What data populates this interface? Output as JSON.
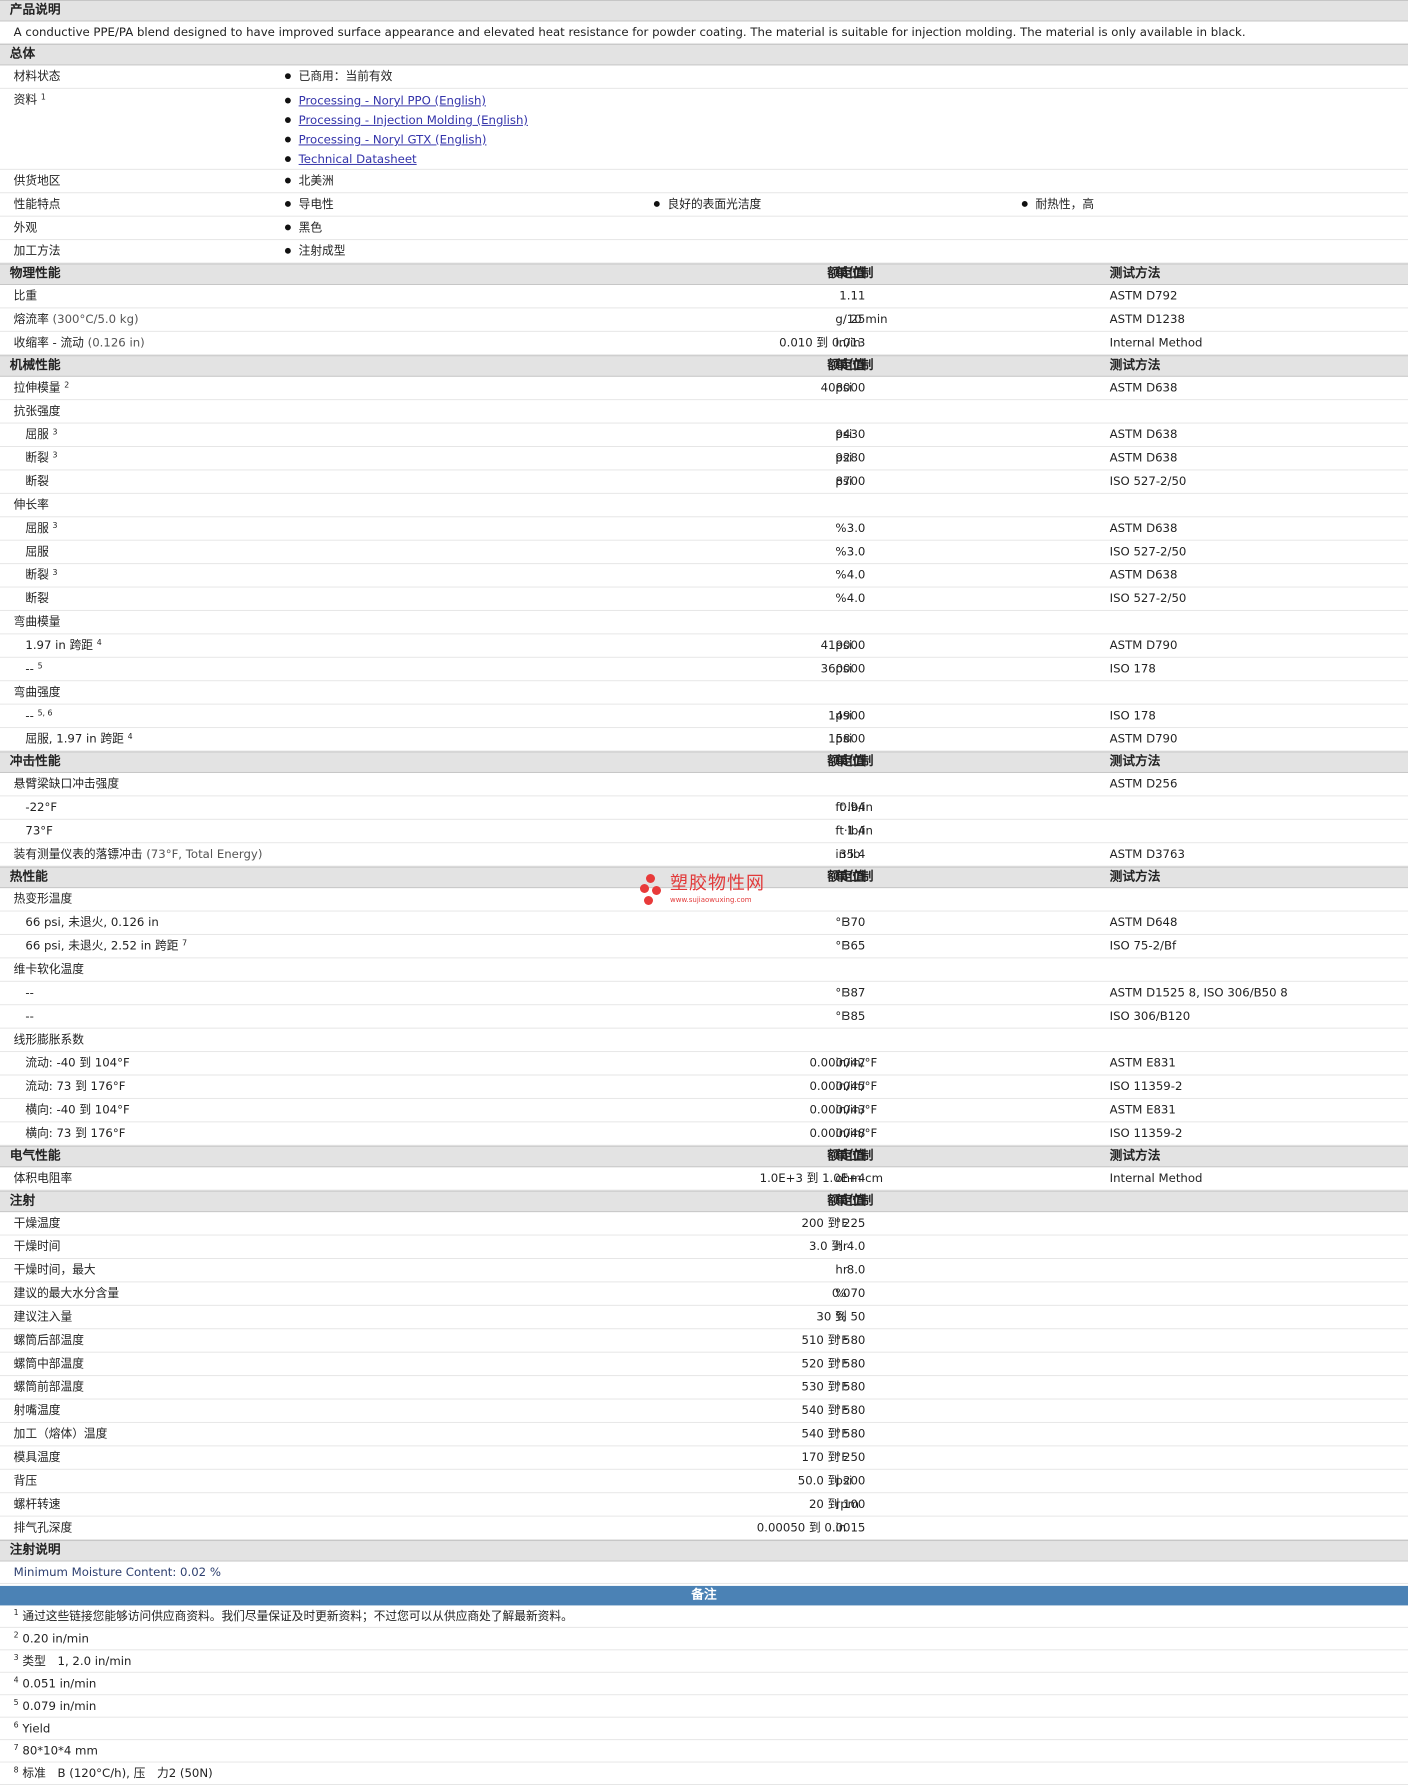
{
  "description": {
    "header": "产品说明",
    "text": "A conductive PPE/PA blend designed to have improved surface appearance and elevated heat resistance for powder coating. The material is suitable for injection molding. The material is only available in black."
  },
  "general": {
    "header": "总体",
    "material_status": {
      "label": "材料状态",
      "value": "已商用：当前有效"
    },
    "documents": {
      "label": "资料",
      "sup": "1",
      "links": [
        "Processing - Noryl PPO (English)",
        "Processing - Injection Molding (English)",
        "Processing - Noryl GTX (English)",
        "Technical Datasheet"
      ]
    },
    "availability": {
      "label": "供货地区",
      "value": "北美洲"
    },
    "features": {
      "label": "性能特点",
      "values": [
        "导电性",
        "良好的表面光洁度",
        "耐热性，高"
      ]
    },
    "appearance": {
      "label": "外观",
      "value": "黑色"
    },
    "processing": {
      "label": "加工方法",
      "value": "注射成型"
    }
  },
  "column_headers": {
    "nominal": "额定值",
    "unit": "单位制",
    "test": "测试方法"
  },
  "physical": {
    "header": "物理性能",
    "rows": [
      {
        "prop": "比重",
        "nom": "1.11",
        "unit": "",
        "test": "ASTM D792"
      },
      {
        "prop": "熔流率",
        "cond": "(300°C/5.0 kg)",
        "nom": "25",
        "unit": "g/10 min",
        "test": "ASTM D1238"
      },
      {
        "prop": "收缩率 - 流动",
        "cond": "(0.126 in)",
        "nom": "0.010 到 0.013",
        "unit": "in/in",
        "test": "Internal Method"
      }
    ]
  },
  "mechanical": {
    "header": "机械性能",
    "rows": [
      {
        "prop": "拉伸模量",
        "sup": "2",
        "nom": "408000",
        "unit": "psi",
        "test": "ASTM D638"
      },
      {
        "prop": "抗张强度",
        "nom": "",
        "unit": "",
        "test": ""
      },
      {
        "prop": "屈服",
        "sup": "3",
        "sub": true,
        "nom": "9430",
        "unit": "psi",
        "test": "ASTM D638"
      },
      {
        "prop": "断裂",
        "sup": "3",
        "sub": true,
        "nom": "9280",
        "unit": "psi",
        "test": "ASTM D638"
      },
      {
        "prop": "断裂",
        "sub": true,
        "nom": "8700",
        "unit": "psi",
        "test": "ISO 527-2/50"
      },
      {
        "prop": "伸长率",
        "nom": "",
        "unit": "",
        "test": ""
      },
      {
        "prop": "屈服",
        "sup": "3",
        "sub": true,
        "nom": "3.0",
        "unit": "%",
        "test": "ASTM D638"
      },
      {
        "prop": "屈服",
        "sub": true,
        "nom": "3.0",
        "unit": "%",
        "test": "ISO 527-2/50"
      },
      {
        "prop": "断裂",
        "sup": "3",
        "sub": true,
        "nom": "4.0",
        "unit": "%",
        "test": "ASTM D638"
      },
      {
        "prop": "断裂",
        "sub": true,
        "nom": "4.0",
        "unit": "%",
        "test": "ISO 527-2/50"
      },
      {
        "prop": "弯曲模量",
        "nom": "",
        "unit": "",
        "test": ""
      },
      {
        "prop": "1.97 in 跨距",
        "sup": "4",
        "sub": true,
        "nom": "419000",
        "unit": "psi",
        "test": "ASTM D790"
      },
      {
        "prop": "--",
        "sup": "5",
        "sub": true,
        "nom": "360000",
        "unit": "psi",
        "test": "ISO 178"
      },
      {
        "prop": "弯曲强度",
        "nom": "",
        "unit": "",
        "test": ""
      },
      {
        "prop": "--",
        "sup": "5, 6",
        "sub": true,
        "nom": "14900",
        "unit": "psi",
        "test": "ISO 178"
      },
      {
        "prop": "屈服, 1.97 in 跨距",
        "sup": "4",
        "sub": true,
        "nom": "15800",
        "unit": "psi",
        "test": "ASTM D790"
      }
    ]
  },
  "impact": {
    "header": "冲击性能",
    "rows": [
      {
        "prop": "悬臂梁缺口冲击强度",
        "nom": "",
        "unit": "",
        "test": "ASTM D256"
      },
      {
        "prop": "-22°F",
        "sub": true,
        "nom": "0.94",
        "unit": "ft·lb/in",
        "test": ""
      },
      {
        "prop": "73°F",
        "sub": true,
        "nom": "1.4",
        "unit": "ft·lb/in",
        "test": ""
      },
      {
        "prop": "装有测量仪表的落镖冲击",
        "cond": "(73°F, Total Energy)",
        "nom": "35.4",
        "unit": "in·lb",
        "test": "ASTM D3763"
      }
    ]
  },
  "thermal": {
    "header": "热性能",
    "rows": [
      {
        "prop": "热变形温度",
        "nom": "",
        "unit": "",
        "test": ""
      },
      {
        "prop": "66 psi, 未退火, 0.126 in",
        "sub": true,
        "nom": "370",
        "unit": "°F",
        "test": "ASTM D648"
      },
      {
        "prop": "66 psi, 未退火, 2.52 in 跨距",
        "sup": "7",
        "sub": true,
        "nom": "365",
        "unit": "°F",
        "test": "ISO 75-2/Bf"
      },
      {
        "prop": "维卡软化温度",
        "nom": "",
        "unit": "",
        "test": ""
      },
      {
        "prop": "--",
        "sub": true,
        "nom": "387",
        "unit": "°F",
        "test": "ASTM D1525 8, ISO 306/B50 8"
      },
      {
        "prop": "--",
        "sub": true,
        "nom": "385",
        "unit": "°F",
        "test": "ISO 306/B120"
      },
      {
        "prop": "线形膨胀系数",
        "nom": "",
        "unit": "",
        "test": ""
      },
      {
        "prop": "流动: -40 到 104°F",
        "sub": true,
        "nom": "0.000042",
        "unit": "in/in/°F",
        "test": "ASTM E831"
      },
      {
        "prop": "流动: 73 到 176°F",
        "sub": true,
        "nom": "0.000045",
        "unit": "in/in/°F",
        "test": "ISO 11359-2"
      },
      {
        "prop": "横向: -40 到 104°F",
        "sub": true,
        "nom": "0.000043",
        "unit": "in/in/°F",
        "test": "ASTM E831"
      },
      {
        "prop": "横向: 73 到 176°F",
        "sub": true,
        "nom": "0.000048",
        "unit": "in/in/°F",
        "test": "ISO 11359-2"
      }
    ]
  },
  "electrical": {
    "header": "电气性能",
    "rows": [
      {
        "prop": "体积电阻率",
        "nom": "1.0E+3 到 1.0E+4",
        "unit": "ohm·cm",
        "test": "Internal Method"
      }
    ]
  },
  "injection": {
    "header": "注射",
    "rows": [
      {
        "prop": "干燥温度",
        "nom": "200 到 225",
        "unit": "°F"
      },
      {
        "prop": "干燥时间",
        "nom": "3.0 到 4.0",
        "unit": "hr"
      },
      {
        "prop": "干燥时间，最大",
        "nom": "8.0",
        "unit": "hr"
      },
      {
        "prop": "建议的最大水分含量",
        "nom": "0.070",
        "unit": "%"
      },
      {
        "prop": "建议注入量",
        "nom": "30 到 50",
        "unit": "%"
      },
      {
        "prop": "螺筒后部温度",
        "nom": "510 到 580",
        "unit": "°F"
      },
      {
        "prop": "螺筒中部温度",
        "nom": "520 到 580",
        "unit": "°F"
      },
      {
        "prop": "螺筒前部温度",
        "nom": "530 到 580",
        "unit": "°F"
      },
      {
        "prop": "射嘴温度",
        "nom": "540 到 580",
        "unit": "°F"
      },
      {
        "prop": "加工（熔体）温度",
        "nom": "540 到 580",
        "unit": "°F"
      },
      {
        "prop": "模具温度",
        "nom": "170 到 250",
        "unit": "°F"
      },
      {
        "prop": "背压",
        "nom": "50.0 到 200",
        "unit": "psi"
      },
      {
        "prop": "螺杆转速",
        "nom": "20 到 100",
        "unit": "rpm"
      },
      {
        "prop": "排气孔深度",
        "nom": "0.00050 到 0.0015",
        "unit": "in"
      }
    ]
  },
  "injection_notes": {
    "header": "注射说明",
    "text": "Minimum Moisture Content: 0.02 %"
  },
  "remarks": {
    "header": "备注",
    "notes": [
      {
        "num": "1",
        "text": "通过这些链接您能够访问供应商资料。我们尽量保证及时更新资料；不过您可以从供应商处了解最新资料。"
      },
      {
        "num": "2",
        "text": "0.20 in/min"
      },
      {
        "num": "3",
        "text": "类型　1, 2.0 in/min"
      },
      {
        "num": "4",
        "text": "0.051 in/min"
      },
      {
        "num": "5",
        "text": "0.079 in/min"
      },
      {
        "num": "6",
        "text": "Yield"
      },
      {
        "num": "7",
        "text": "80*10*4 mm"
      },
      {
        "num": "8",
        "text": "标准　B (120°C/h), 压　力2 (50N)"
      }
    ]
  },
  "watermark": {
    "name": "塑胶物性网",
    "url": "www.sujiaowuxing.com"
  },
  "colors": {
    "remarks_bar": "#4b82b5",
    "section_bg": "#e3e3e3",
    "link": "#3333aa",
    "watermark": "#e23b3b"
  }
}
